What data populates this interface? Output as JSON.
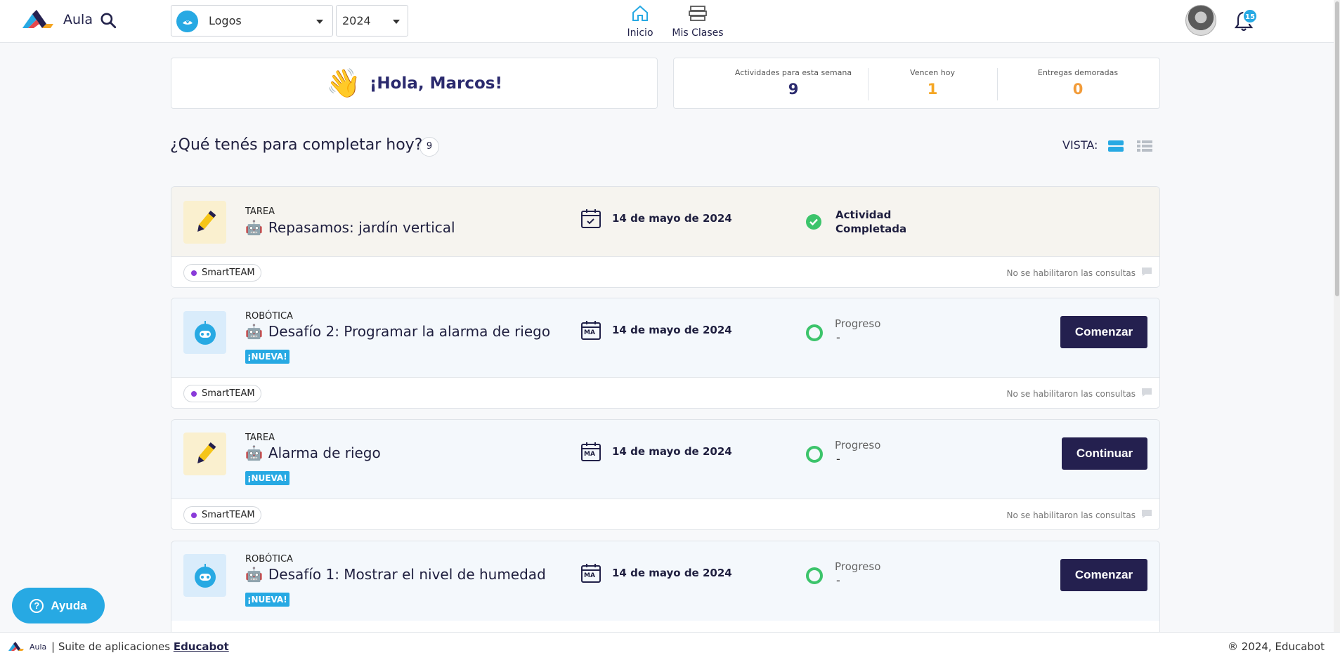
{
  "header": {
    "app_name": "Aula",
    "school": "Logos",
    "year": "2024",
    "nav": [
      {
        "label": "Inicio"
      },
      {
        "label": "Mis Clases"
      }
    ],
    "notifications_count": "15"
  },
  "greeting": {
    "text": "¡Hola, Marcos!"
  },
  "stats": [
    {
      "label": "Actividades para esta semana",
      "value": "9",
      "color": "#2b2a6e"
    },
    {
      "label": "Vencen hoy",
      "value": "1",
      "color": "#f5a623"
    },
    {
      "label": "Entregas demoradas",
      "value": "0",
      "color": "#f29b38"
    }
  ],
  "section": {
    "title": "¿Qué tenés para completar hoy?",
    "count": "9",
    "vista_label": "VISTA:"
  },
  "activities": [
    {
      "type": "TAREA",
      "title": "Repasamos: jardín vertical",
      "date": "14 de mayo de 2024",
      "status": "Actividad Completada",
      "team": "SmartTEAM",
      "consult": "No se habilitaron las consultas"
    },
    {
      "type": "ROBÓTICA",
      "title": "Desafío 2: Programar la alarma de riego",
      "badge": "¡NUEVA!",
      "date": "14 de mayo de 2024",
      "calendar_day": "MA",
      "progress_label": "Progreso",
      "progress_value": "-",
      "action": "Comenzar",
      "team": "SmartTEAM",
      "consult": "No se habilitaron las consultas"
    },
    {
      "type": "TAREA",
      "title": "Alarma de riego",
      "badge": "¡NUEVA!",
      "date": "14 de mayo de 2024",
      "calendar_day": "MA",
      "progress_label": "Progreso",
      "progress_value": "-",
      "action": "Continuar",
      "team": "SmartTEAM",
      "consult": "No se habilitaron las consultas"
    },
    {
      "type": "ROBÓTICA",
      "title": "Desafío 1: Mostrar el nivel de humedad",
      "badge": "¡NUEVA!",
      "date": "14 de mayo de 2024",
      "calendar_day": "MA",
      "progress_label": "Progreso",
      "progress_value": "-",
      "action": "Comenzar"
    }
  ],
  "help": {
    "label": "Ayuda"
  },
  "footer": {
    "aula": "Aula",
    "suite": "| Suite de aplicaciones",
    "brand": "Educabot",
    "copyright": "® 2024, Educabot"
  },
  "colors": {
    "primary": "#24204f",
    "accent": "#27a9e3",
    "success": "#3cc46b",
    "team_dot": "#8a3bd9"
  }
}
